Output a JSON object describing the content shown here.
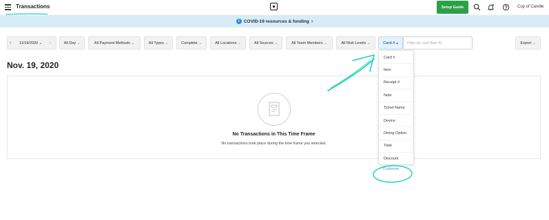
{
  "header": {
    "title": "Transactions",
    "setup_guide": "Setup Guide",
    "account": "Cup of Candle",
    "icons": [
      "menu-icon",
      "square-logo-icon",
      "search-icon",
      "bell-icon",
      "help-icon"
    ]
  },
  "banner": {
    "text": "COVID-19 resources & funding",
    "chevron": "›"
  },
  "filters": {
    "date": "11/19/2020",
    "date_chevron": "⌄",
    "all_day": "All Day",
    "payment_methods": "All Payment Methods",
    "types": "All Types",
    "status": "Complete",
    "locations": "All Locations",
    "sources": "All Sources",
    "team_members": "All Team Members",
    "risk_levels": "All Risk Levels",
    "card": "Card #",
    "card_placeholder": "Filter by card (last 4)",
    "export": "Export"
  },
  "date_heading": "Nov. 19, 2020",
  "empty_state": {
    "title": "No Transactions in This Time Frame",
    "subtitle": "No transactions took place during the time frame you selected."
  },
  "dropdown": {
    "items": [
      "Card #",
      "Item",
      "Receipt #",
      "Note",
      "Ticket Name",
      "Device",
      "Dining Option",
      "Total",
      "Discount"
    ],
    "customer": "Customer"
  },
  "colors": {
    "accent_green": "#2ca048",
    "banner_bg": "#d7ecf6",
    "annotation_teal": "#19d3b2",
    "link_blue": "#4a92d6"
  }
}
